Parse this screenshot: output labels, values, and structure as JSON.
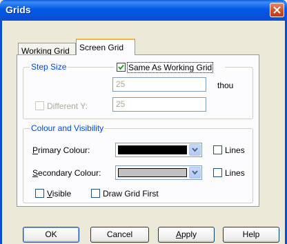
{
  "window": {
    "title": "Grids"
  },
  "tabs": [
    {
      "label": "Working Grid",
      "active": false
    },
    {
      "label": "Screen Grid",
      "active": true
    }
  ],
  "step_size": {
    "legend": "Step Size",
    "same_as_working": {
      "label": "Same As Working Grid",
      "checked": true
    },
    "x_value": "25",
    "unit": "thou",
    "different_y": {
      "label": "Different Y:",
      "checked": false
    },
    "y_value": "25"
  },
  "colour": {
    "legend": "Colour and Visibility",
    "primary": {
      "label": "Primary Colour:",
      "accel": "P",
      "rest": "rimary Colour:",
      "swatch_color": "#000000",
      "lines_label": "Lines",
      "lines_checked": false
    },
    "secondary": {
      "label": "Secondary Colour:",
      "accel": "S",
      "rest": "econdary Colour:",
      "swatch_color": "#c0c0c0",
      "lines_label": "Lines",
      "lines_checked": false
    },
    "visible": {
      "label": "Visible",
      "accel": "V",
      "rest": "isible",
      "checked": false
    },
    "draw_first": {
      "label": "Draw Grid First",
      "checked": false
    }
  },
  "buttons": {
    "ok": "OK",
    "cancel": "Cancel",
    "apply_accel": "A",
    "apply_rest": "pply",
    "help": "Help"
  },
  "colors": {
    "title_bar": "#0058e6",
    "group_legend": "#0046d5",
    "disabled_text": "#aca899"
  }
}
